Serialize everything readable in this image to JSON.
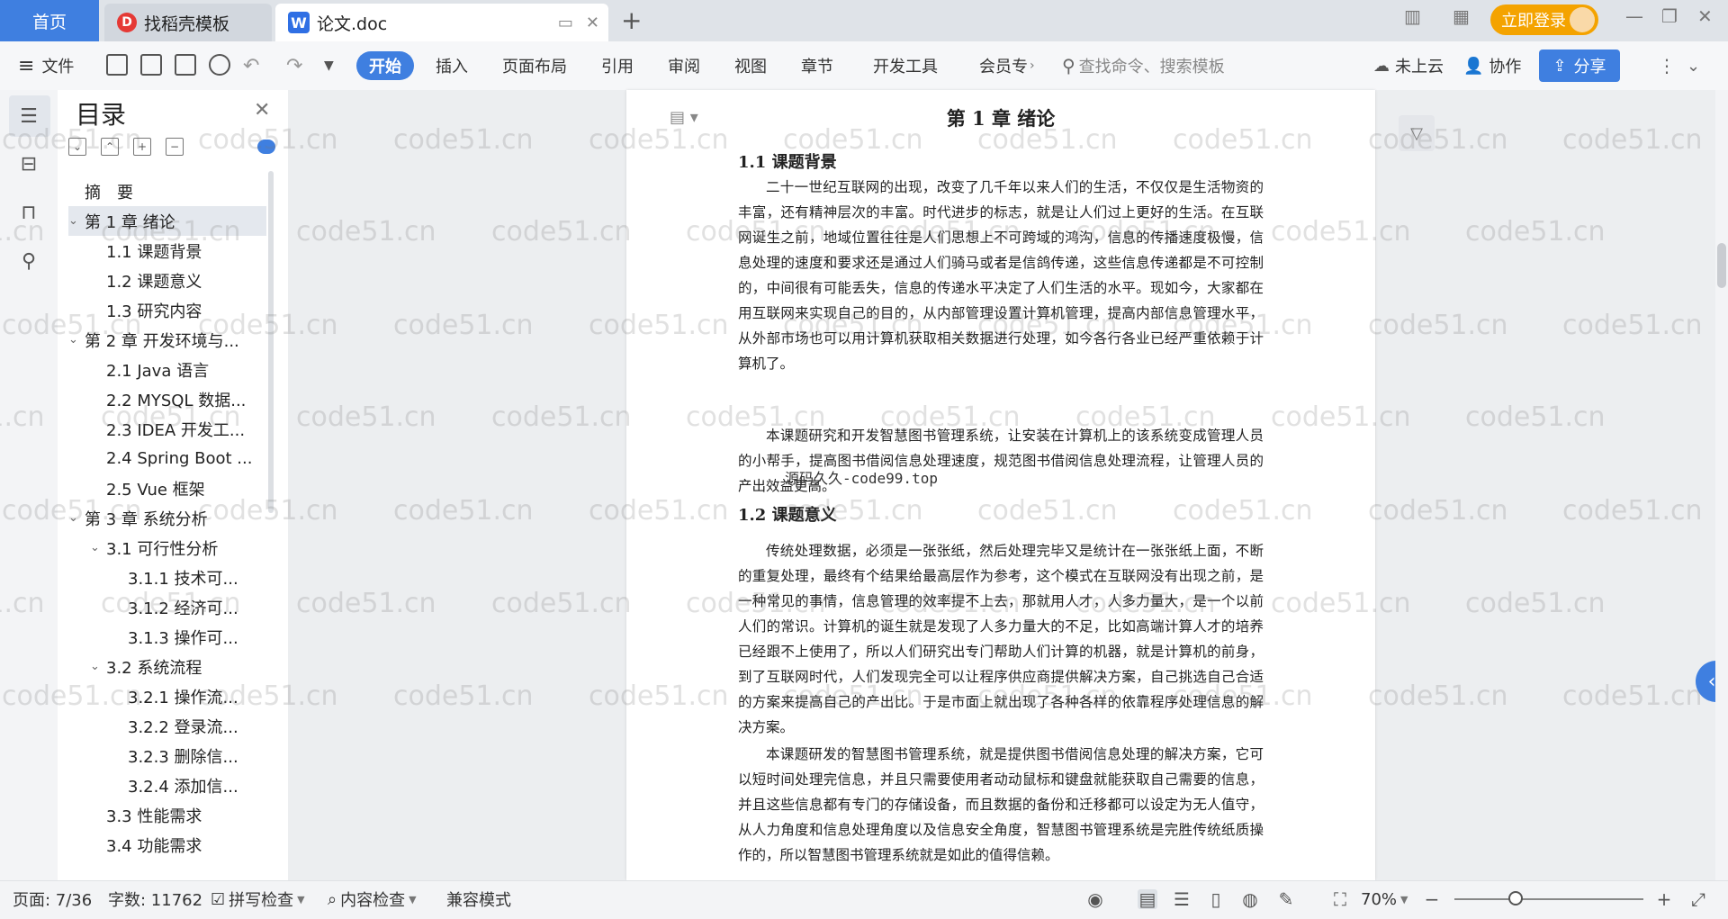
{
  "tabs": {
    "home": "首页",
    "template_store": "找稻壳模板",
    "document": "论文.doc"
  },
  "topbar": {
    "login_label": "立即登录"
  },
  "ribbon": {
    "file_label": "文件",
    "tabs": [
      "开始",
      "插入",
      "页面布局",
      "引用",
      "审阅",
      "视图",
      "章节",
      "开发工具",
      "会员专"
    ],
    "search_placeholder": "查找命令、搜索模板",
    "cloud_label": "未上云",
    "collab_label": "协作",
    "share_label": "分享"
  },
  "toc": {
    "title": "目录",
    "items": [
      {
        "label": "摘　要",
        "level": 1,
        "caret": ""
      },
      {
        "label": "第 1 章  绪论",
        "level": 1,
        "caret": "v",
        "selected": true
      },
      {
        "label": "1.1  课题背景",
        "level": 2,
        "caret": ""
      },
      {
        "label": "1.2  课题意义",
        "level": 2,
        "caret": ""
      },
      {
        "label": "1.3  研究内容",
        "level": 2,
        "caret": ""
      },
      {
        "label": "第 2 章  开发环境与...",
        "level": 1,
        "caret": "v"
      },
      {
        "label": "2.1 Java 语言",
        "level": 2,
        "caret": ""
      },
      {
        "label": "2.2 MYSQL 数据...",
        "level": 2,
        "caret": ""
      },
      {
        "label": "2.3 IDEA 开发工...",
        "level": 2,
        "caret": ""
      },
      {
        "label": "2.4 Spring Boot ...",
        "level": 2,
        "caret": ""
      },
      {
        "label": "2.5 Vue 框架",
        "level": 2,
        "caret": ""
      },
      {
        "label": "第 3 章  系统分析",
        "level": 1,
        "caret": "v"
      },
      {
        "label": "3.1  可行性分析",
        "level": 2,
        "caret": "v"
      },
      {
        "label": "3.1.1  技术可...",
        "level": 3,
        "caret": ""
      },
      {
        "label": "3.1.2  经济可...",
        "level": 3,
        "caret": ""
      },
      {
        "label": "3.1.3  操作可...",
        "level": 3,
        "caret": ""
      },
      {
        "label": "3.2  系统流程",
        "level": 2,
        "caret": "v"
      },
      {
        "label": "3.2.1  操作流...",
        "level": 3,
        "caret": ""
      },
      {
        "label": "3.2.2  登录流...",
        "level": 3,
        "caret": ""
      },
      {
        "label": "3.2.3  删除信...",
        "level": 3,
        "caret": ""
      },
      {
        "label": "3.2.4  添加信...",
        "level": 3,
        "caret": ""
      },
      {
        "label": "3.3  性能需求",
        "level": 2,
        "caret": ""
      },
      {
        "label": "3.4  功能需求",
        "level": 2,
        "caret": ""
      }
    ]
  },
  "document": {
    "chapter_title": "第 1 章  绪论",
    "section1_title": "1.1  课题背景",
    "section1_p1": "二十一世纪互联网的出现，改变了几千年以来人们的生活，不仅仅是生活物资的丰富，还有精神层次的丰富。时代进步的标志，就是让人们过上更好的生活。在互联网诞生之前，地域位置往往是人们思想上不可跨域的鸿沟，信息的传播速度极慢，信息处理的速度和要求还是通过人们骑马或者是信鸽传递，这些信息传递都是不可控制的，中间很有可能丢失，信息的传递水平决定了人们生活的水平。现如今，大家都在用互联网来实现自己的目的，从内部管理设置计算机管理，提高内部信息管理水平，从外部市场也可以用计算机获取相关数据进行处理，如今各行各业已经严重依赖于计算机了。",
    "section1_p2": "本课题研究和开发智慧图书管理系统，让安装在计算机上的该系统变成管理人员的小帮手，提高图书借阅信息处理速度，规范图书借阅信息处理流程，让管理人员的产出效益更高。",
    "stamp": "源码久久-code99.top",
    "section2_title": "1.2  课题意义",
    "section2_p1": "传统处理数据，必须是一张张纸，然后处理完毕又是统计在一张张纸上面，不断的重复处理，最终有个结果给最高层作为参考，这个模式在互联网没有出现之前，是一种常见的事情，信息管理的效率提不上去，那就用人才，人多力量大，是一个以前人们的常识。计算机的诞生就是发现了人多力量大的不足，比如高端计算人才的培养已经跟不上使用了，所以人们研究出专门帮助人们计算的机器，就是计算机的前身，到了互联网时代，人们发现完全可以让程序供应商提供解决方案，自己挑选自己合适的方案来提高自己的产出比。于是市面上就出现了各种各样的依靠程序处理信息的解决方案。",
    "section2_p2": "本课题研发的智慧图书管理系统，就是提供图书借阅信息处理的解决方案，它可以短时间处理完信息，并且只需要使用者动动鼠标和键盘就能获取自己需要的信息，并且这些信息都有专门的存储设备，而且数据的备份和迁移都可以设定为无人值守，从人力角度和信息处理角度以及信息安全角度，智慧图书管理系统是完胜传统纸质操作的，所以智慧图书管理系统就是如此的值得信赖。"
  },
  "statusbar": {
    "page": "页面: 7/36",
    "words": "字数: 11762",
    "spell_check": "拼写检查",
    "content_check": "内容检查",
    "compat_mode": "兼容模式",
    "zoom": "70%"
  },
  "watermark": "code51.cn"
}
